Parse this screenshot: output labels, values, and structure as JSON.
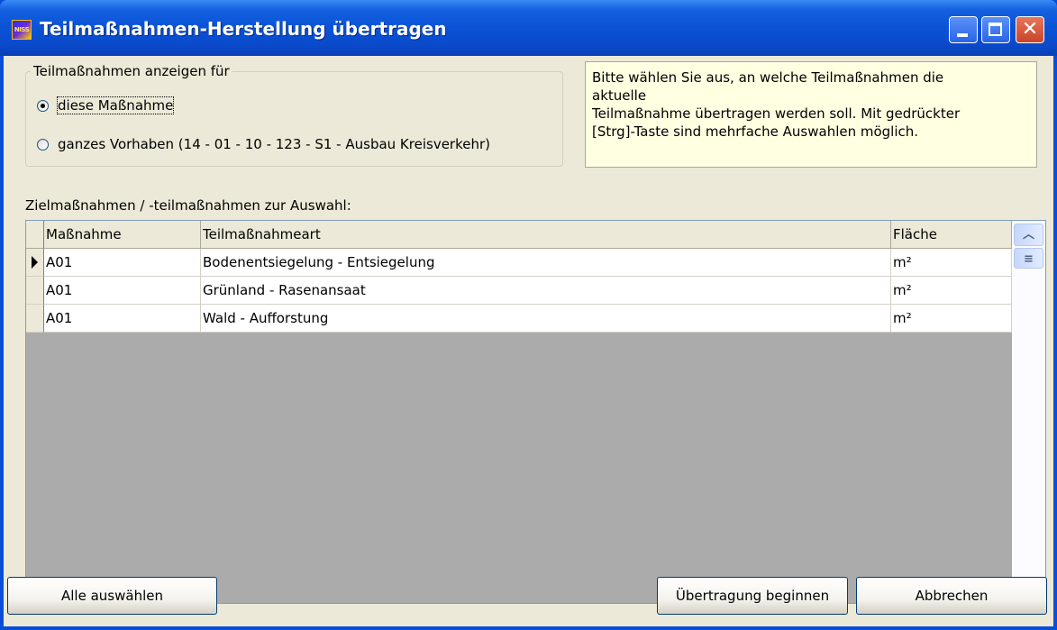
{
  "window": {
    "title": "Teilmaßnahmen-Herstellung übertragen",
    "icon_text": "NISS"
  },
  "filter": {
    "legend": "Teilmaßnahmen anzeigen für",
    "options": [
      {
        "label": "diese Maßnahme",
        "checked": true
      },
      {
        "label": "ganzes Vorhaben (14 - 01 - 10 - 123 - S1 - Ausbau Kreisverkehr)",
        "checked": false
      }
    ]
  },
  "info": {
    "lines": [
      "Bitte wählen Sie aus, an welche Teilmaßnahmen die",
      "aktuelle",
      "Teilmaßnahme übertragen werden soll. Mit gedrückter",
      "[Strg]-Taste sind mehrfache Auswahlen möglich."
    ]
  },
  "grid": {
    "label": "Zielmaßnahmen / -teilmaßnahmen zur Auswahl:",
    "columns": [
      "Maßnahme",
      "Teilmaßnahmeart",
      "Fläche"
    ],
    "rows": [
      {
        "massnahme": "A01",
        "art": "Bodenentsiegelung - Entsiegelung",
        "flaeche": "m²",
        "current": true
      },
      {
        "massnahme": "A01",
        "art": "Grünland - Rasenansaat",
        "flaeche": "m²",
        "current": false
      },
      {
        "massnahme": "A01",
        "art": "Wald - Aufforstung",
        "flaeche": "m²",
        "current": false
      }
    ]
  },
  "buttons": {
    "select_all": "Alle auswählen",
    "start": "Übertragung beginnen",
    "cancel": "Abbrechen"
  },
  "icons": {
    "minimize": "minimize-icon",
    "maximize": "maximize-icon",
    "close": "close-icon",
    "scroll_up": "chevron-up-icon",
    "scroll_down": "chevron-down-icon",
    "row_marker": "current-row-arrow-icon"
  }
}
